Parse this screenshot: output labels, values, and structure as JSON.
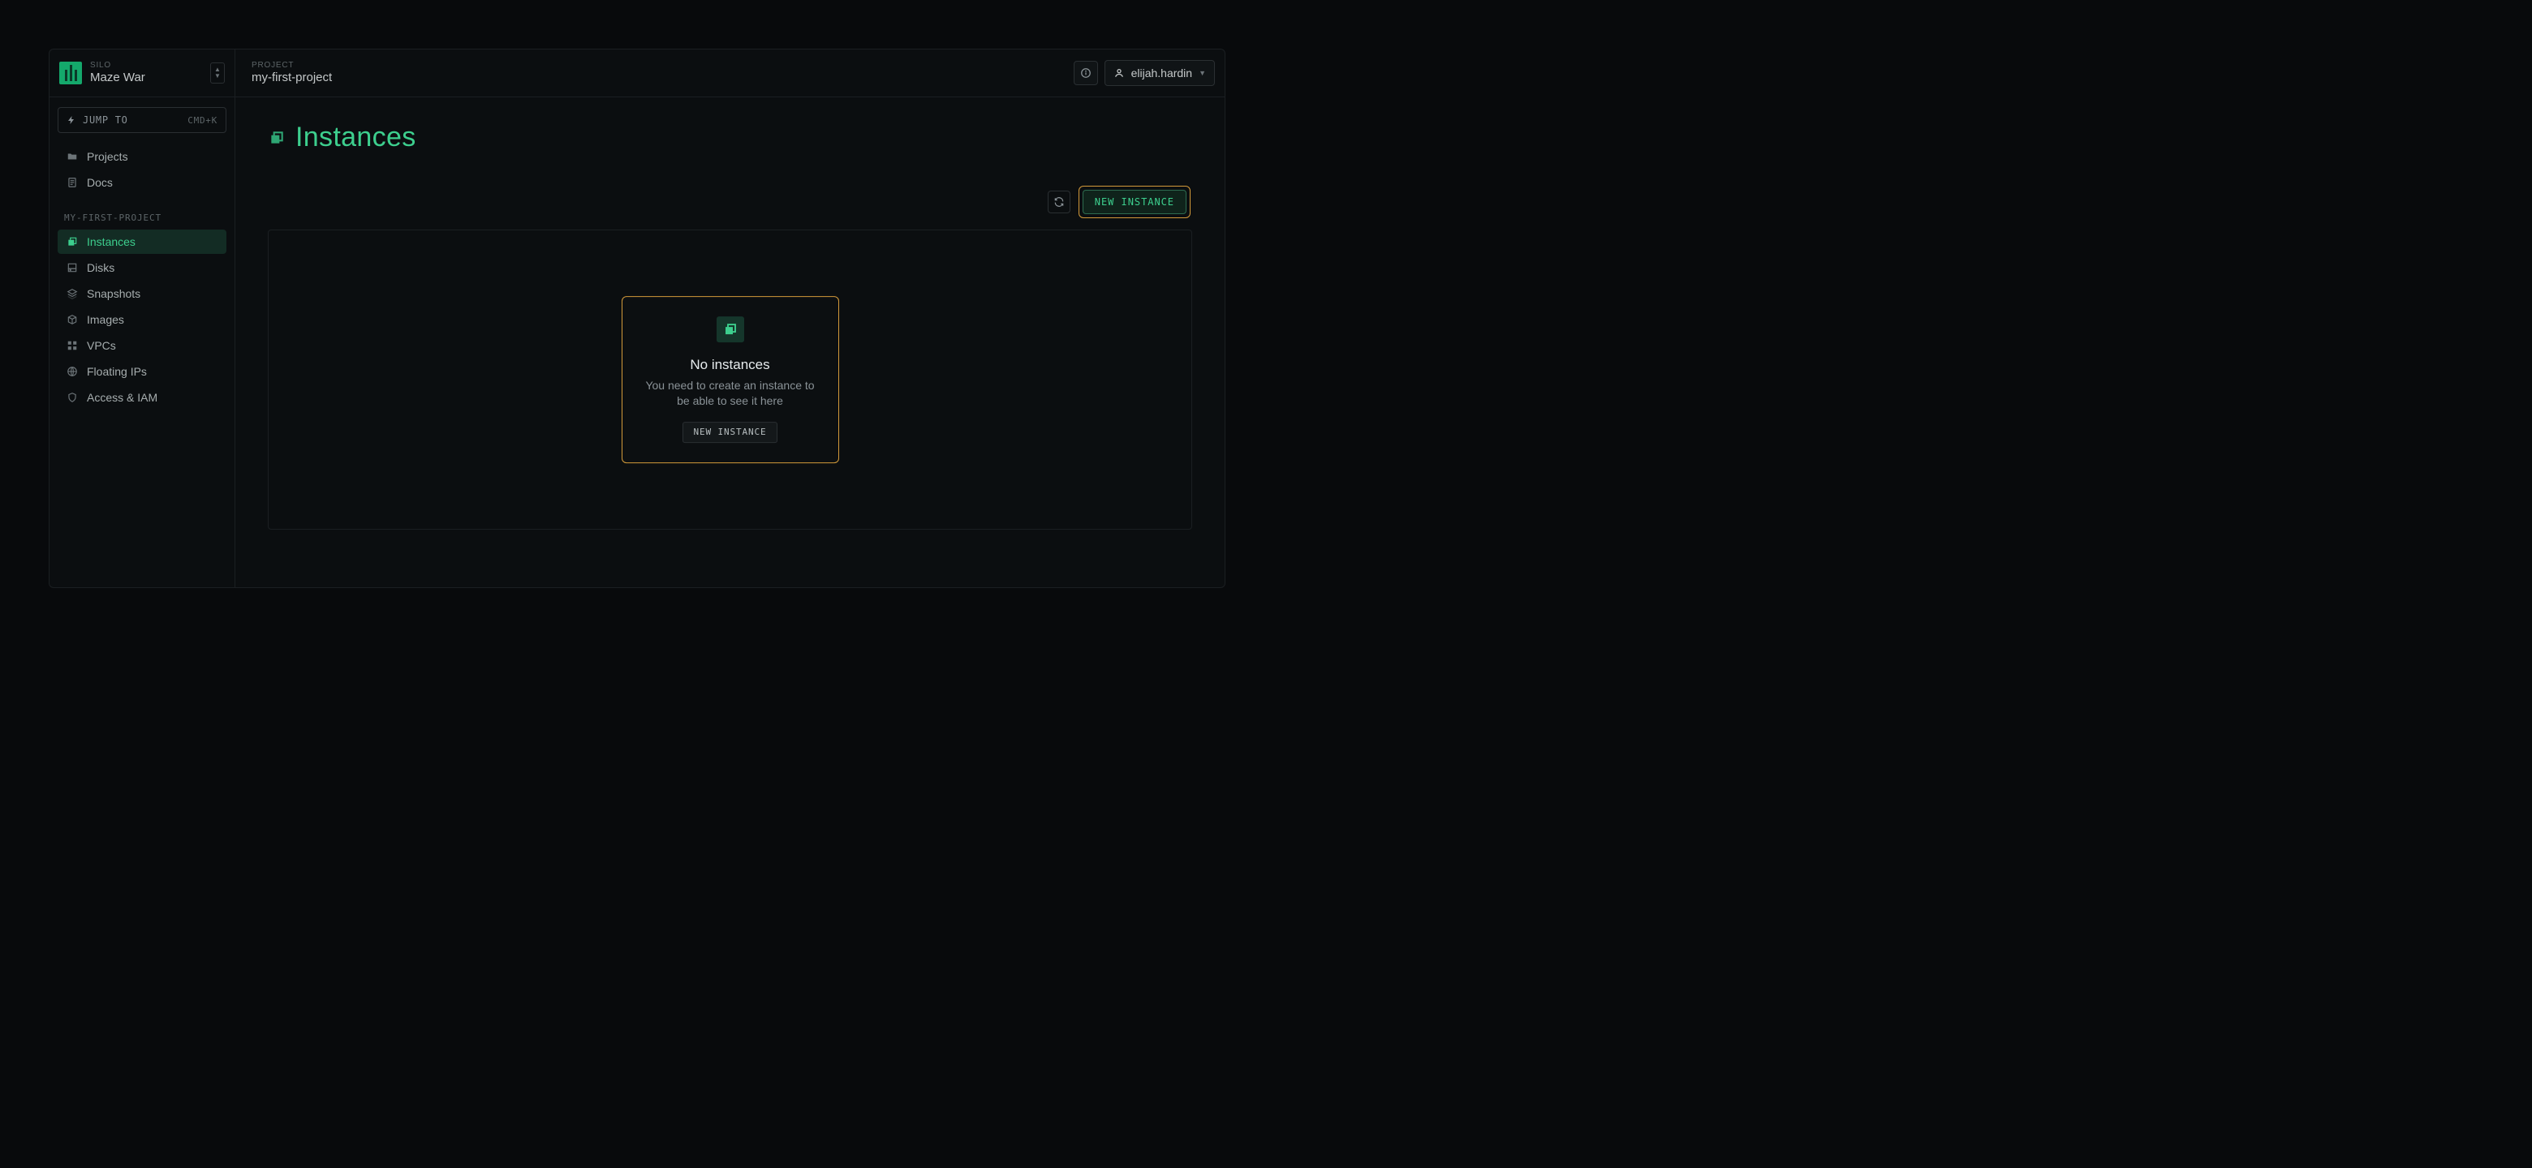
{
  "header": {
    "silo_label": "SILO",
    "silo_name": "Maze War",
    "project_label": "PROJECT",
    "project_name": "my-first-project",
    "user_name": "elijah.hardin"
  },
  "sidebar": {
    "jump_label": "JUMP TO",
    "jump_hint": "CMD+K",
    "top_items": [
      {
        "label": "Projects"
      },
      {
        "label": "Docs"
      }
    ],
    "project_group_title": "MY-FIRST-PROJECT",
    "project_items": [
      {
        "label": "Instances",
        "active": true
      },
      {
        "label": "Disks"
      },
      {
        "label": "Snapshots"
      },
      {
        "label": "Images"
      },
      {
        "label": "VPCs"
      },
      {
        "label": "Floating IPs"
      },
      {
        "label": "Access & IAM"
      }
    ]
  },
  "page": {
    "title": "Instances",
    "new_instance_label": "NEW INSTANCE"
  },
  "empty_state": {
    "title": "No instances",
    "description": "You need to create an instance to be able to see it here",
    "button_label": "NEW INSTANCE"
  }
}
